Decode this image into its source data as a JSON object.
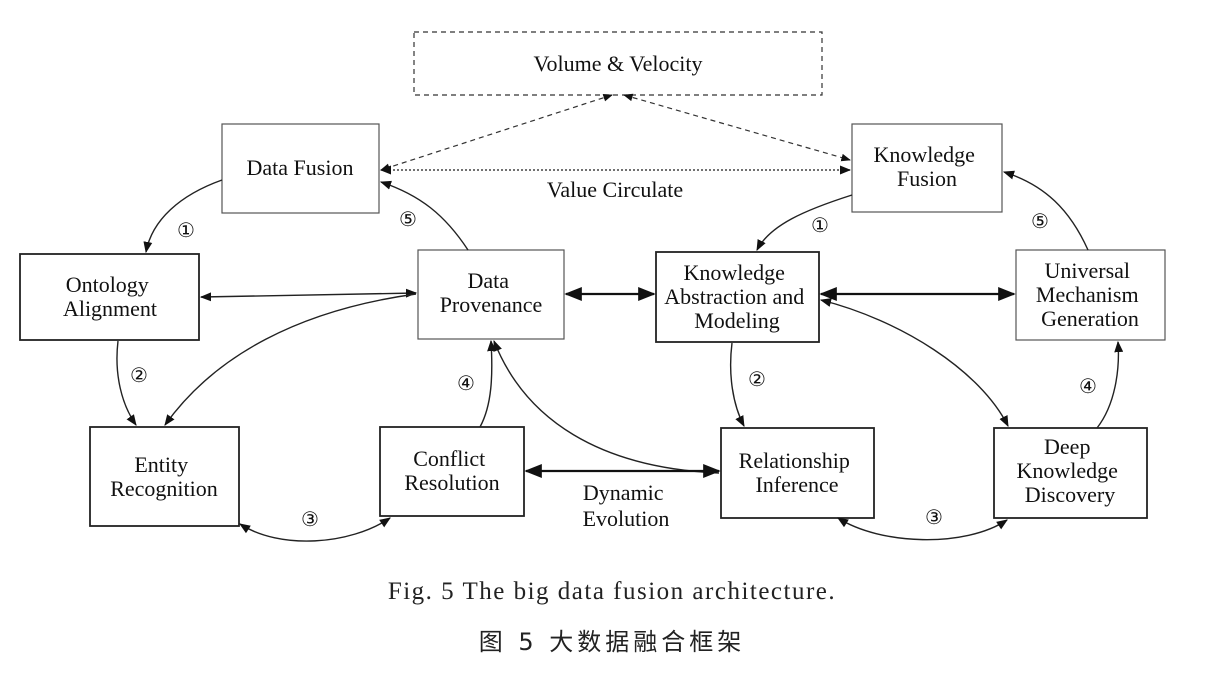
{
  "nodes": {
    "volume_velocity": [
      "Volume & Velocity"
    ],
    "data_fusion": [
      "Data Fusion"
    ],
    "knowledge_fusion": [
      "Knowledge",
      "Fusion"
    ],
    "ontology_alignment": [
      "Ontology",
      "Alignment"
    ],
    "data_provenance": [
      "Data",
      "Provenance"
    ],
    "knowledge_abstraction": [
      "Knowledge",
      "Abstraction and",
      "Modeling"
    ],
    "universal_mechanism": [
      "Universal",
      "Mechanism",
      "Generation"
    ],
    "entity_recognition": [
      "Entity",
      "Recognition"
    ],
    "conflict_resolution": [
      "Conflict",
      "Resolution"
    ],
    "relationship_inference": [
      "Relationship",
      "Inference"
    ],
    "deep_knowledge": [
      "Deep",
      "Knowledge",
      "Discovery"
    ]
  },
  "edge_labels": {
    "value_circulate": "Value Circulate",
    "dynamic_evolution": [
      "Dynamic",
      "Evolution"
    ]
  },
  "steps": {
    "left_1": "①",
    "left_2": "②",
    "left_3": "③",
    "left_4": "④",
    "left_5": "⑤",
    "right_1": "①",
    "right_2": "②",
    "right_3": "③",
    "right_4": "④",
    "right_5": "⑤"
  },
  "caption": {
    "english": "Fig. 5   The big data fusion architecture.",
    "chinese": "图 5   大数据融合框架"
  }
}
